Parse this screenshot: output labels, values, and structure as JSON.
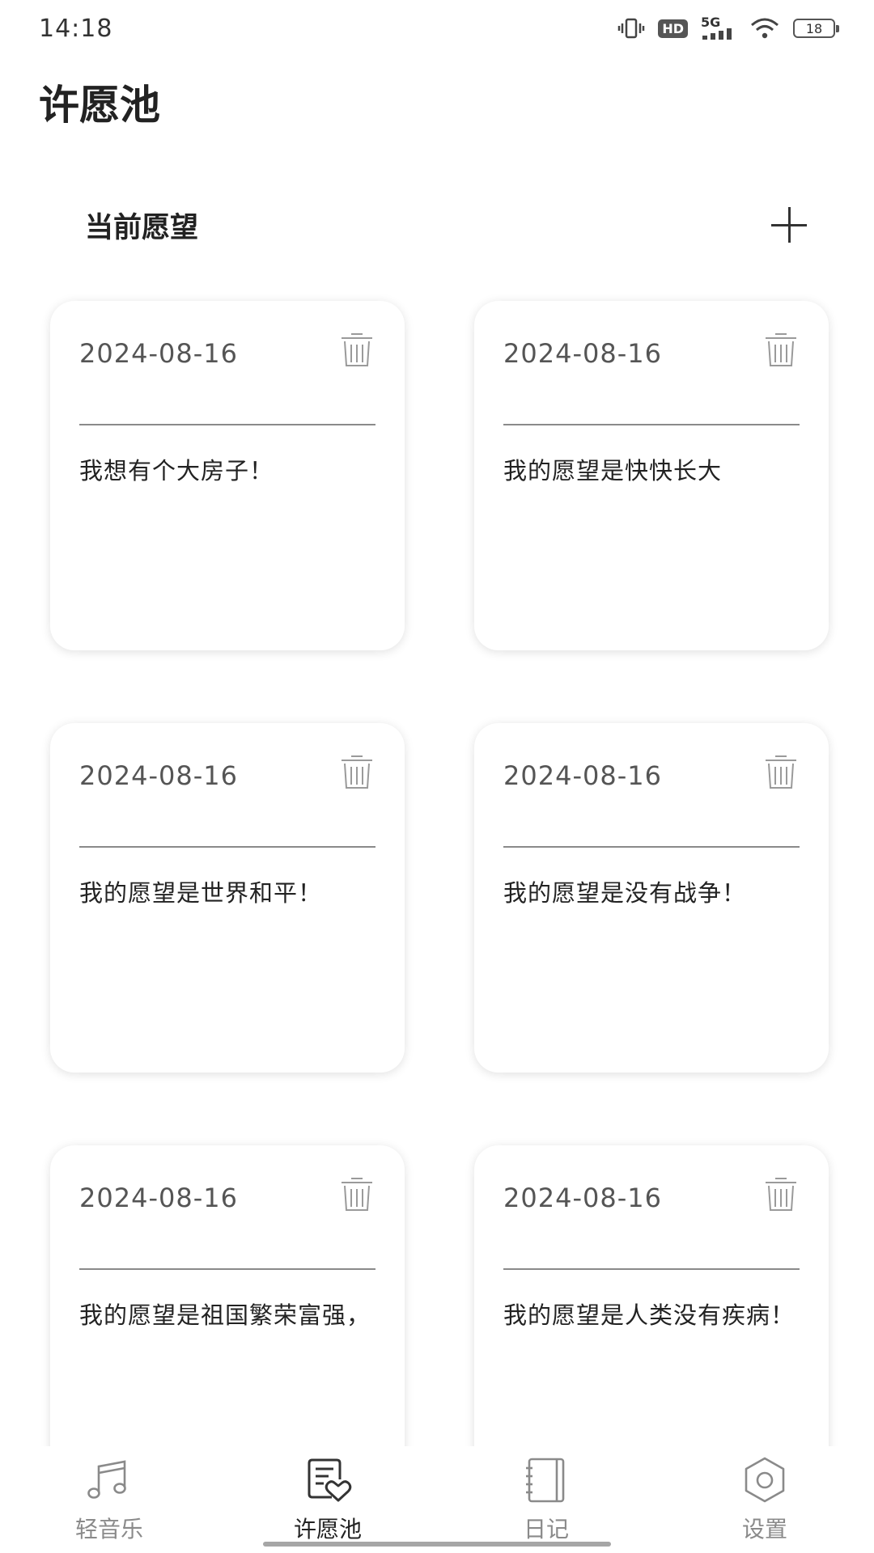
{
  "status_bar": {
    "time": "14:18",
    "hd": "HD",
    "network": "5G",
    "battery": "18"
  },
  "page": {
    "title": "许愿池",
    "section_title": "当前愿望"
  },
  "wishes": [
    {
      "date": "2024-08-16",
      "text": "我想有个大房子！"
    },
    {
      "date": "2024-08-16",
      "text": "我的愿望是快快长大"
    },
    {
      "date": "2024-08-16",
      "text": "我的愿望是世界和平！"
    },
    {
      "date": "2024-08-16",
      "text": "我的愿望是没有战争！"
    },
    {
      "date": "2024-08-16",
      "text": "我的愿望是祖国繁荣富强，"
    },
    {
      "date": "2024-08-16",
      "text": "我的愿望是人类没有疾病！"
    }
  ],
  "bottom_nav": {
    "items": [
      {
        "label": "轻音乐",
        "icon": "music-note-icon"
      },
      {
        "label": "许愿池",
        "icon": "wish-list-heart-icon"
      },
      {
        "label": "日记",
        "icon": "diary-book-icon"
      },
      {
        "label": "设置",
        "icon": "gear-icon"
      }
    ],
    "active_index": 1
  },
  "colors": {
    "text_primary": "#222222",
    "text_secondary": "#8a8a8a",
    "card_divider": "#8a8a8a"
  }
}
